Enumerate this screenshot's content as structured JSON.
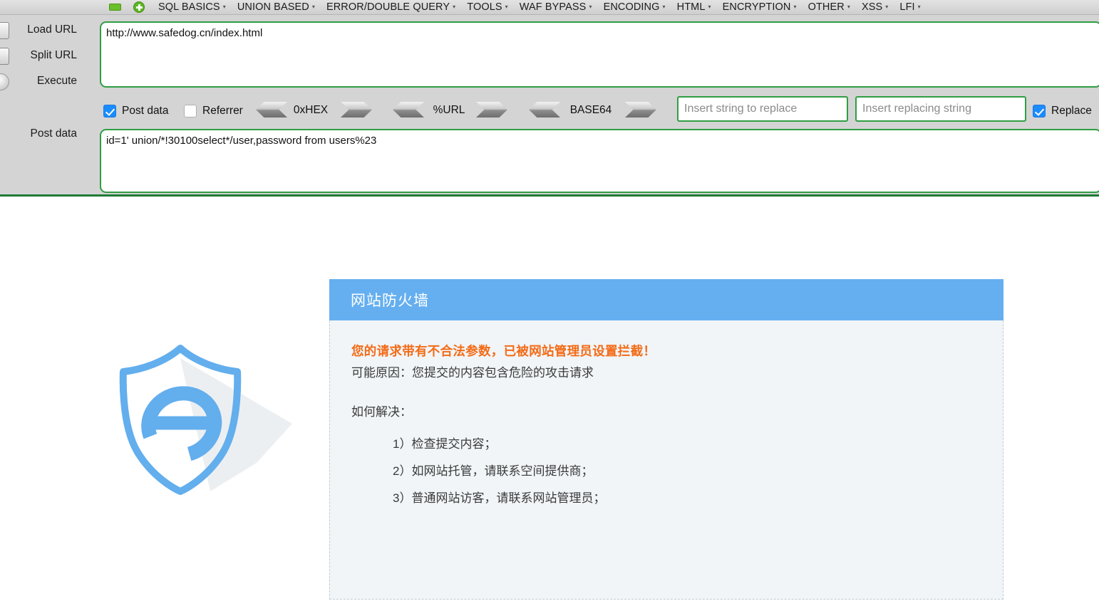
{
  "hackbar": {
    "menubar": {
      "icons": [
        "minimize-icon",
        "add-icon"
      ],
      "items": [
        {
          "label": "SQL BASICS",
          "caret": "▾"
        },
        {
          "label": "UNION BASED",
          "caret": "▾"
        },
        {
          "label": "ERROR/DOUBLE QUERY",
          "caret": "▾"
        },
        {
          "label": "TOOLS",
          "caret": "▾"
        },
        {
          "label": "WAF BYPASS",
          "caret": "▾"
        },
        {
          "label": "ENCODING",
          "caret": "▾"
        },
        {
          "label": "HTML",
          "caret": "▾"
        },
        {
          "label": "ENCRYPTION",
          "caret": "▾"
        },
        {
          "label": "OTHER",
          "caret": "▾"
        },
        {
          "label": "XSS",
          "caret": "▾"
        },
        {
          "label": "LFI",
          "caret": "▾"
        }
      ]
    },
    "actions": [
      {
        "label": "Load URL",
        "icon": "load-url-icon"
      },
      {
        "label": "Split URL",
        "icon": "split-url-icon"
      },
      {
        "label": "Execute",
        "icon": "execute-icon"
      }
    ],
    "url_field": {
      "value": "http://www.safedog.cn/index.html"
    },
    "post_data_label": "Post data",
    "post_data_field": {
      "value": "id=1' union/*!30100select*/user,password from users%23"
    },
    "toolbar": {
      "checkboxes": [
        {
          "label": "Post data",
          "checked": true
        },
        {
          "label": "Referrer",
          "checked": false
        }
      ],
      "encoders": [
        {
          "label": "0xHEX",
          "decode_icon": "chevron-left-icon",
          "encode_icon": "chevron-right-icon"
        },
        {
          "label": "%URL",
          "decode_icon": "chevron-left-icon",
          "encode_icon": "chevron-right-icon"
        },
        {
          "label": "BASE64",
          "decode_icon": "chevron-left-icon",
          "encode_icon": "chevron-right-icon"
        }
      ],
      "replace_search": {
        "value": "",
        "placeholder": "Insert string to replace"
      },
      "replace_with": {
        "value": "",
        "placeholder": "Insert replacing string"
      },
      "replace_checkbox": {
        "label": "Replace",
        "checked": true
      }
    }
  },
  "firewall": {
    "logo_icon": "shield-e-logo-icon",
    "header_title": "网站防火墙",
    "alert": "您的请求带有不合法参数，已被网站管理员设置拦截！",
    "reason": "可能原因：您提交的内容包含危险的攻击请求",
    "howto_label": "如何解决：",
    "steps": [
      "1）检查提交内容；",
      "2）如网站托管，请联系空间提供商；",
      "3）普通网站访客，请联系网站管理员；"
    ]
  },
  "colors": {
    "panel_bg": "#d4d4d4",
    "green_border": "#2f9e43",
    "checkbox_blue": "#1a8cff",
    "header_blue": "#65aff0",
    "alert_orange": "#f36b16",
    "card_bg": "#f1f5f8"
  }
}
